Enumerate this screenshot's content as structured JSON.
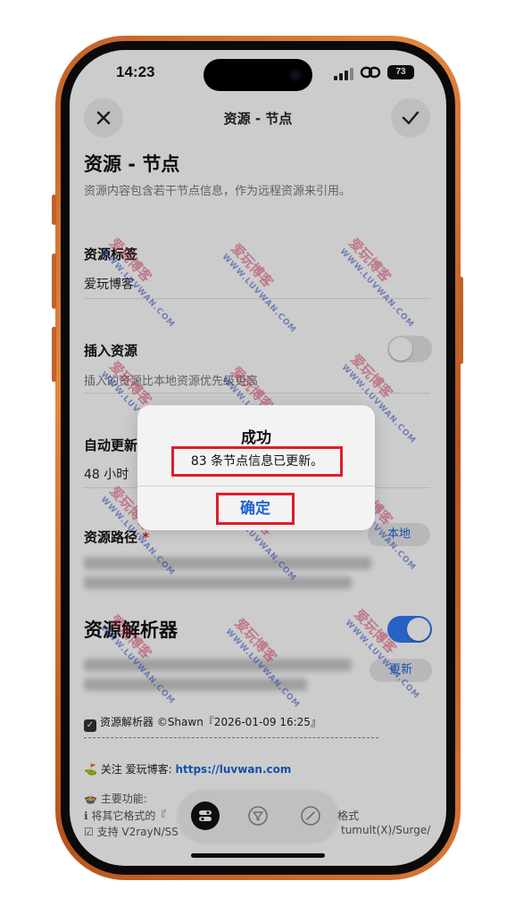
{
  "status_bar": {
    "time": "14:23",
    "battery": "73"
  },
  "nav": {
    "title": "资源 - 节点"
  },
  "page": {
    "title": "资源 - 节点",
    "subtitle": "资源内容包含若干节点信息，作为远程资源来引用。"
  },
  "fields": {
    "tag_label": "资源标签",
    "tag_value": "爱玩博客",
    "insert_label": "插入资源",
    "insert_hint": "插入的资源比本地资源优先级更高",
    "auto_update_label": "自动更新",
    "auto_update_value": "48 小时",
    "path_label": "资源路径",
    "required_mark": "*",
    "local_button": "本地"
  },
  "parser": {
    "title": "资源解析器",
    "update_button": "更新",
    "checked_line": "资源解析器 ©Shawn『2026-01-09 16:25』",
    "follow_prefix": "关注 爱玩博客: ",
    "follow_link": "https://luvwan.com",
    "features_title": "主要功能:",
    "features_line1": "将其它格式的『",
    "features_line1_tail": "格式",
    "features_line2": "支持 V2rayN/SS",
    "features_line2_tail": "tumult(X)/Surge/"
  },
  "dialog": {
    "title": "成功",
    "message": "83 条节点信息已更新。",
    "ok_button": "确定"
  },
  "watermark": {
    "cn": "爱玩博客",
    "en": "WWW.LUVWAN.COM"
  },
  "colors": {
    "frame": "#d4722f",
    "accent": "#1b63d6",
    "toggle_on": "#2f7bf5",
    "highlight": "#e01b2b"
  }
}
